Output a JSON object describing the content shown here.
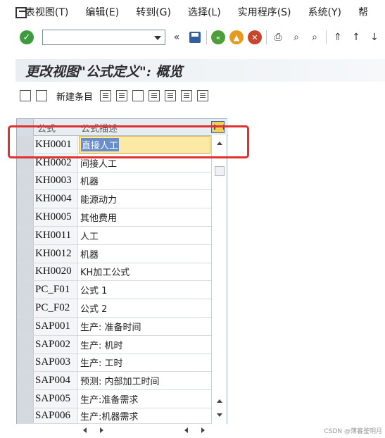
{
  "menu": {
    "items": [
      {
        "label": "表视图(T)",
        "name": "menu-table-view"
      },
      {
        "label": "编辑(E)",
        "name": "menu-edit"
      },
      {
        "label": "转到(G)",
        "name": "menu-goto"
      },
      {
        "label": "选择(L)",
        "name": "menu-select"
      },
      {
        "label": "实用程序(S)",
        "name": "menu-utilities"
      },
      {
        "label": "系统(Y)",
        "name": "menu-system"
      },
      {
        "label": "帮",
        "name": "menu-help"
      }
    ]
  },
  "toolbar": {
    "command_value": "",
    "icons": [
      "back-icon",
      "exit-icon",
      "cancel-icon",
      "print-icon",
      "find-icon",
      "find-next-icon",
      "first-page-icon",
      "previous-page-icon",
      "next-page-icon"
    ]
  },
  "title": "更改视图\"公式定义\": 概览",
  "app_toolbar": {
    "new_entries": "新建条目"
  },
  "table": {
    "columns": [
      "公式",
      "公式描述"
    ],
    "rows": [
      {
        "code": "KH0001",
        "desc": "直接人工",
        "active": true
      },
      {
        "code": "KH0002",
        "desc": "间接人工"
      },
      {
        "code": "KH0003",
        "desc": "机器"
      },
      {
        "code": "KH0004",
        "desc": "能源动力"
      },
      {
        "code": "KH0005",
        "desc": "其他费用"
      },
      {
        "code": "KH0011",
        "desc": "人工"
      },
      {
        "code": "KH0012",
        "desc": "机器"
      },
      {
        "code": "KH0020",
        "desc": "KH加工公式"
      },
      {
        "code": "PC_F01",
        "desc": "公式 1"
      },
      {
        "code": "PC_F02",
        "desc": "公式 2"
      },
      {
        "code": "SAP001",
        "desc": "生产: 准备时间"
      },
      {
        "code": "SAP002",
        "desc": "生产: 机时"
      },
      {
        "code": "SAP003",
        "desc": "生产: 工时"
      },
      {
        "code": "SAP004",
        "desc": "预测: 内部加工时间"
      },
      {
        "code": "SAP005",
        "desc": "生产:准备需求"
      },
      {
        "code": "SAP006",
        "desc": "生产:机器需求"
      }
    ]
  },
  "watermark": "CSDN @薄暮鉴明月"
}
